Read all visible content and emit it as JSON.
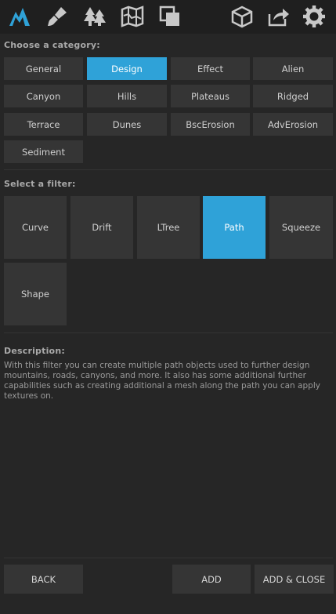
{
  "toolbar": {
    "left_icons": [
      "mountain-logo-icon",
      "brush-icon",
      "trees-icon",
      "map-icon",
      "layers-icon"
    ],
    "right_icons": [
      "cube-icon",
      "share-icon",
      "gear-icon"
    ],
    "accent": "#2fa2d8"
  },
  "category": {
    "label": "Choose a category:",
    "items": [
      "General",
      "Design",
      "Effect",
      "Alien",
      "Canyon",
      "Hills",
      "Plateaus",
      "Ridged",
      "Terrace",
      "Dunes",
      "BscErosion",
      "AdvErosion",
      "Sediment"
    ],
    "selected": "Design"
  },
  "filter": {
    "label": "Select a filter:",
    "items": [
      "Curve",
      "Drift",
      "LTree",
      "Path",
      "Squeeze",
      "Shape"
    ],
    "selected": "Path"
  },
  "description": {
    "label": "Description:",
    "text": "With this filter you can create multiple path objects used to further design mountains, roads, canyons, and more. It also has some additional further capabilities such as creating additional a mesh along the path you can apply textures on."
  },
  "footer": {
    "back": "BACK",
    "add": "ADD",
    "add_close": "ADD & CLOSE"
  }
}
